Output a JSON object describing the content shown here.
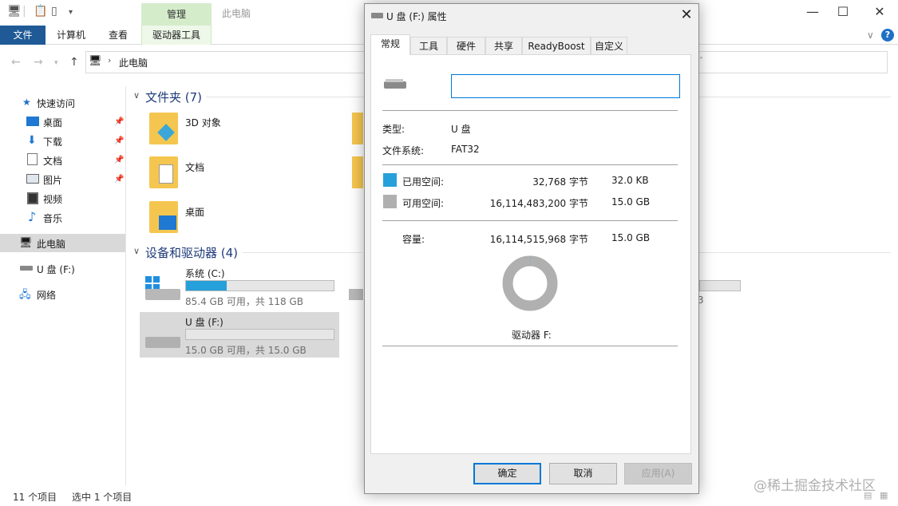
{
  "explorer": {
    "window_title": "此电脑",
    "ribbon": {
      "file": "文件",
      "tabs": [
        "计算机",
        "查看"
      ],
      "context_group": "管理",
      "context_tab": "驱动器工具"
    },
    "address": "此电脑",
    "sidebar": {
      "quick_access": "快速访问",
      "items": [
        "桌面",
        "下载",
        "文档",
        "图片",
        "视频",
        "音乐"
      ],
      "this_pc": "此电脑",
      "usb": "U 盘 (F:)",
      "network": "网络"
    },
    "folders_header": "文件夹 (7)",
    "folders": [
      "3D 对象",
      "文档",
      "桌面"
    ],
    "devices_header": "设备和驱动器 (4)",
    "drives": [
      {
        "name": "系统 (C:)",
        "sub": "85.4 GB 可用，共 118 GB",
        "used_fraction": 0.277
      },
      {
        "name": "U 盘 (F:)",
        "sub": "15.0 GB 可用，共 15.0 GB",
        "used_fraction": 0.0
      }
    ],
    "partial_drive_sub": "3",
    "status": {
      "count": "11 个项目",
      "selected": "选中 1 个项目"
    }
  },
  "dialog": {
    "title": "U 盘 (F:) 属性",
    "close": "✕",
    "tabs": [
      "常规",
      "工具",
      "硬件",
      "共享",
      "ReadyBoost",
      "自定义"
    ],
    "name_value": "",
    "type_label": "类型:",
    "type_value": "U 盘",
    "fs_label": "文件系统:",
    "fs_value": "FAT32",
    "used_label": "已用空间:",
    "used_bytes": "32,768 字节",
    "used_size": "32.0 KB",
    "free_label": "可用空间:",
    "free_bytes": "16,114,483,200 字节",
    "free_size": "15.0 GB",
    "cap_label": "容量:",
    "cap_bytes": "16,114,515,968 字节",
    "cap_size": "15.0 GB",
    "drive_label": "驱动器 F:",
    "used_fraction": 2e-06,
    "buttons": {
      "ok": "确定",
      "cancel": "取消",
      "apply": "应用(A)"
    },
    "colors": {
      "used": "#26a0da",
      "free": "#b0b0b0"
    }
  },
  "watermark": "@稀土掘金技术社区"
}
